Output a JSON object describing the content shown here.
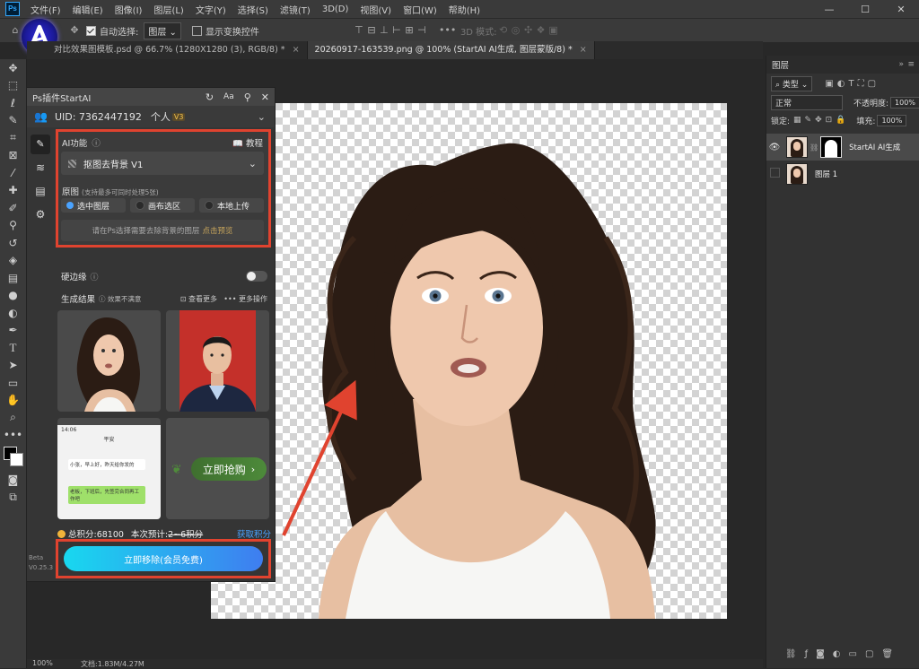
{
  "app": {
    "logo_text": "Ps"
  },
  "menubar": {
    "items": [
      "文件(F)",
      "编辑(E)",
      "图像(I)",
      "图层(L)",
      "文字(Y)",
      "选择(S)",
      "滤镜(T)",
      "3D(D)",
      "视图(V)",
      "窗口(W)",
      "帮助(H)"
    ]
  },
  "options_bar": {
    "auto_select_label": "自动选择:",
    "auto_select_value": "图层",
    "show_transform_label": "显示变换控件",
    "mode_3d_label": "3D 模式:"
  },
  "tabs": [
    {
      "label": "对比效果图模板.psd @ 66.7% (1280X1280 (3), RGB/8) *",
      "active": false
    },
    {
      "label": "20260917-163539.png @ 100% (StartAI AI生成, 图层蒙版/8) *",
      "active": true
    }
  ],
  "plugin": {
    "title": "Ps插件StartAI",
    "header_icons": [
      "refresh-icon",
      "font-size-icon",
      "pin-icon",
      "close-icon"
    ],
    "uid_label": "UID: 7362447192",
    "account_type": "个人",
    "vip_badge": "V3",
    "ai_function_label": "AI功能",
    "tutorial_label": "教程",
    "function_select": "抠图去背景 V1",
    "source_label": "原图",
    "source_hint": "(支持最多可同时处理5张)",
    "source_options": [
      {
        "label": "选中图层",
        "selected": true
      },
      {
        "label": "画布选区",
        "selected": false
      },
      {
        "label": "本地上传",
        "selected": false
      }
    ],
    "select_hint": "请在Ps选择需要去除背景的图层",
    "preview_link": "点击预览",
    "hard_edge_label": "硬边缘",
    "results_label": "生成结果",
    "results_feedback": "效果不满意",
    "view_more": "查看更多",
    "more_actions": "更多操作",
    "chat_time": "14:06",
    "chat_title": "平安",
    "chat_messages": [
      "小张，早上好，昨天给你发的",
      "老板，下班后，先签完合同再工作吧"
    ],
    "promo_button": "立即抢购",
    "total_points": "总积分:68100",
    "estimate_label": "本次预计:",
    "estimate_value": "2~6积分",
    "get_points": "获取积分",
    "remove_button": "立即移除(会员免费)",
    "beta_label": "Beta",
    "version": "V0.25.3"
  },
  "layers_panel": {
    "title": "图层",
    "filter_value": "类型",
    "blend_mode": "正常",
    "opacity_label": "不透明度:",
    "opacity_value": "100%",
    "lock_label": "锁定:",
    "fill_label": "填充:",
    "fill_value": "100%",
    "layers": [
      {
        "name": "StartAI AI生成",
        "visible": true,
        "selected": true
      },
      {
        "name": "图层 1",
        "visible": false,
        "selected": false
      }
    ]
  },
  "status_bar": {
    "zoom": "100%",
    "doc_info": "文档:1.83M/4.27M"
  },
  "colors": {
    "accent_red": "#e0432f",
    "button_gradient_start": "#18d8ef",
    "button_gradient_end": "#3f7df0",
    "ui_bg": "#282828",
    "panel_bg": "#353535"
  }
}
